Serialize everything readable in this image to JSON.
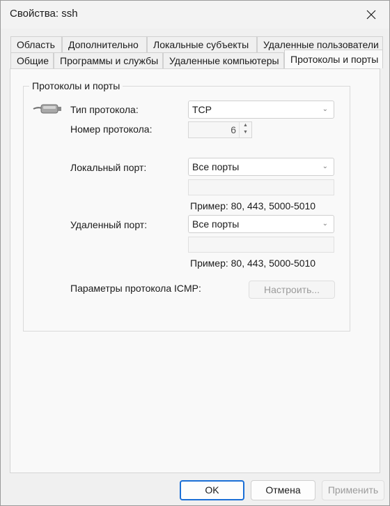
{
  "window": {
    "title": "Свойства: ssh"
  },
  "tabs": {
    "row1": [
      "Область",
      "Дополнительно",
      "Локальные субъекты",
      "Удаленные пользователи"
    ],
    "row2": [
      "Общие",
      "Программы и службы",
      "Удаленные компьютеры",
      "Протоколы и порты"
    ],
    "active": "Протоколы и порты"
  },
  "group": {
    "title": "Протоколы и порты",
    "protocol_type_label": "Тип протокола:",
    "protocol_type_value": "TCP",
    "protocol_number_label": "Номер протокола:",
    "protocol_number_value": "6",
    "local_port_label": "Локальный порт:",
    "local_port_value": "Все порты",
    "local_port_example": "Пример: 80, 443, 5000-5010",
    "remote_port_label": "Удаленный порт:",
    "remote_port_value": "Все порты",
    "remote_port_example": "Пример: 80, 443, 5000-5010",
    "icmp_label": "Параметры протокола ICMP:",
    "icmp_button": "Настроить..."
  },
  "buttons": {
    "ok": "OK",
    "cancel": "Отмена",
    "apply": "Применить"
  },
  "icons": {
    "close": "close-icon",
    "protocol": "network-cable-icon"
  },
  "colors": {
    "accent": "#1b6fd6"
  }
}
